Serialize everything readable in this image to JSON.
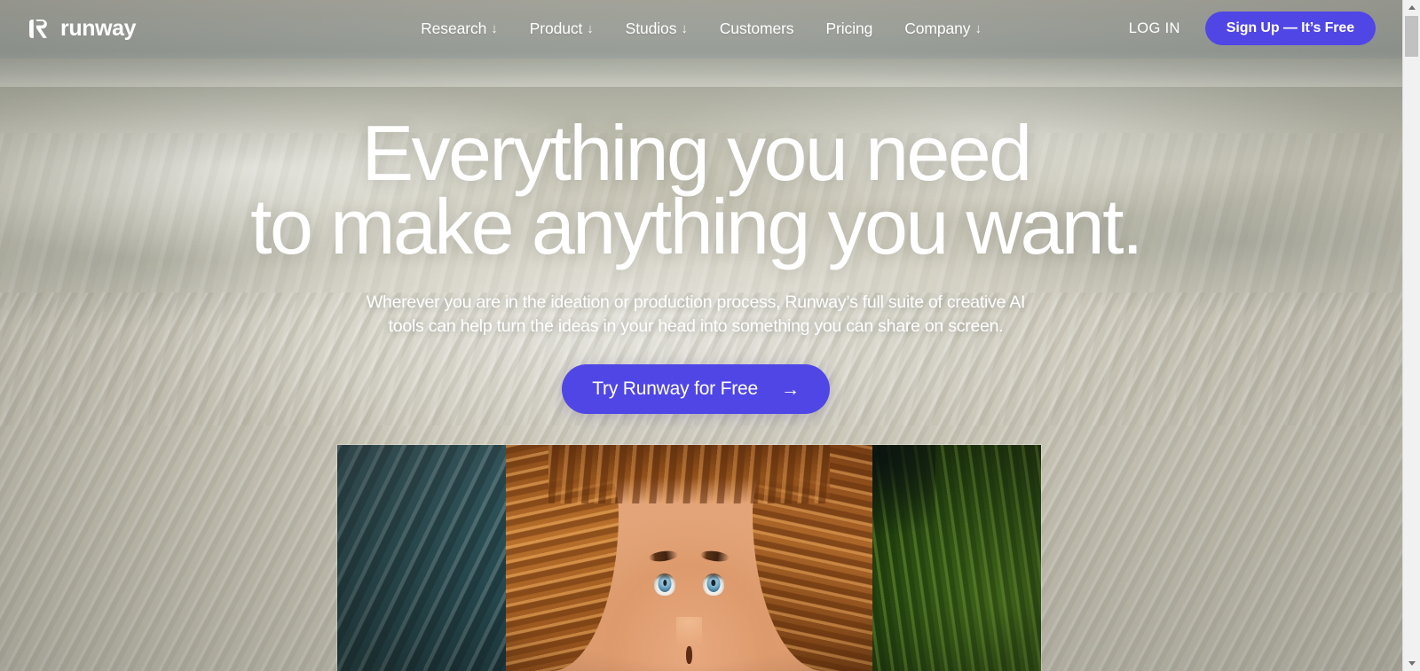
{
  "site": {
    "brand_name": "runway",
    "brand_mark": "runway-logo-icon"
  },
  "nav": {
    "items": [
      {
        "label": "Research",
        "has_dropdown": true,
        "caret": "↓"
      },
      {
        "label": "Product",
        "has_dropdown": true,
        "caret": "↓"
      },
      {
        "label": "Studios",
        "has_dropdown": true,
        "caret": "↓"
      },
      {
        "label": "Customers",
        "has_dropdown": false,
        "caret": ""
      },
      {
        "label": "Pricing",
        "has_dropdown": false,
        "caret": ""
      },
      {
        "label": "Company",
        "has_dropdown": true,
        "caret": "↓"
      }
    ],
    "login_label": "LOG IN",
    "signup_label": "Sign Up — It’s Free"
  },
  "hero": {
    "headline_line1": "Everything you need",
    "headline_line2": "to make anything you want.",
    "subhead_line1": "Wherever you are in the ideation or production process, Runway’s full suite of creative AI tools",
    "subhead_line2": "can help turn the ideas in your head into something you can share on screen.",
    "cta_label": "Try Runway for Free",
    "cta_arrow": "→",
    "background_description": "sand dunes desert landscape"
  },
  "showcase": {
    "media_description": "close-up portrait of a red-haired woman lying in grass looking upward"
  },
  "scrollbar": {
    "up_arrow": "scroll-up-arrow-icon",
    "down_arrow": "scroll-down-arrow-icon",
    "position": "top"
  },
  "colors": {
    "accent": "#5046E5",
    "text_on_hero": "#FFFFFF",
    "sand": "#C9C6B7",
    "sky": "#A0A49C",
    "scrollbar_track": "#F1F1F1",
    "scrollbar_thumb": "#C1C1C1"
  }
}
